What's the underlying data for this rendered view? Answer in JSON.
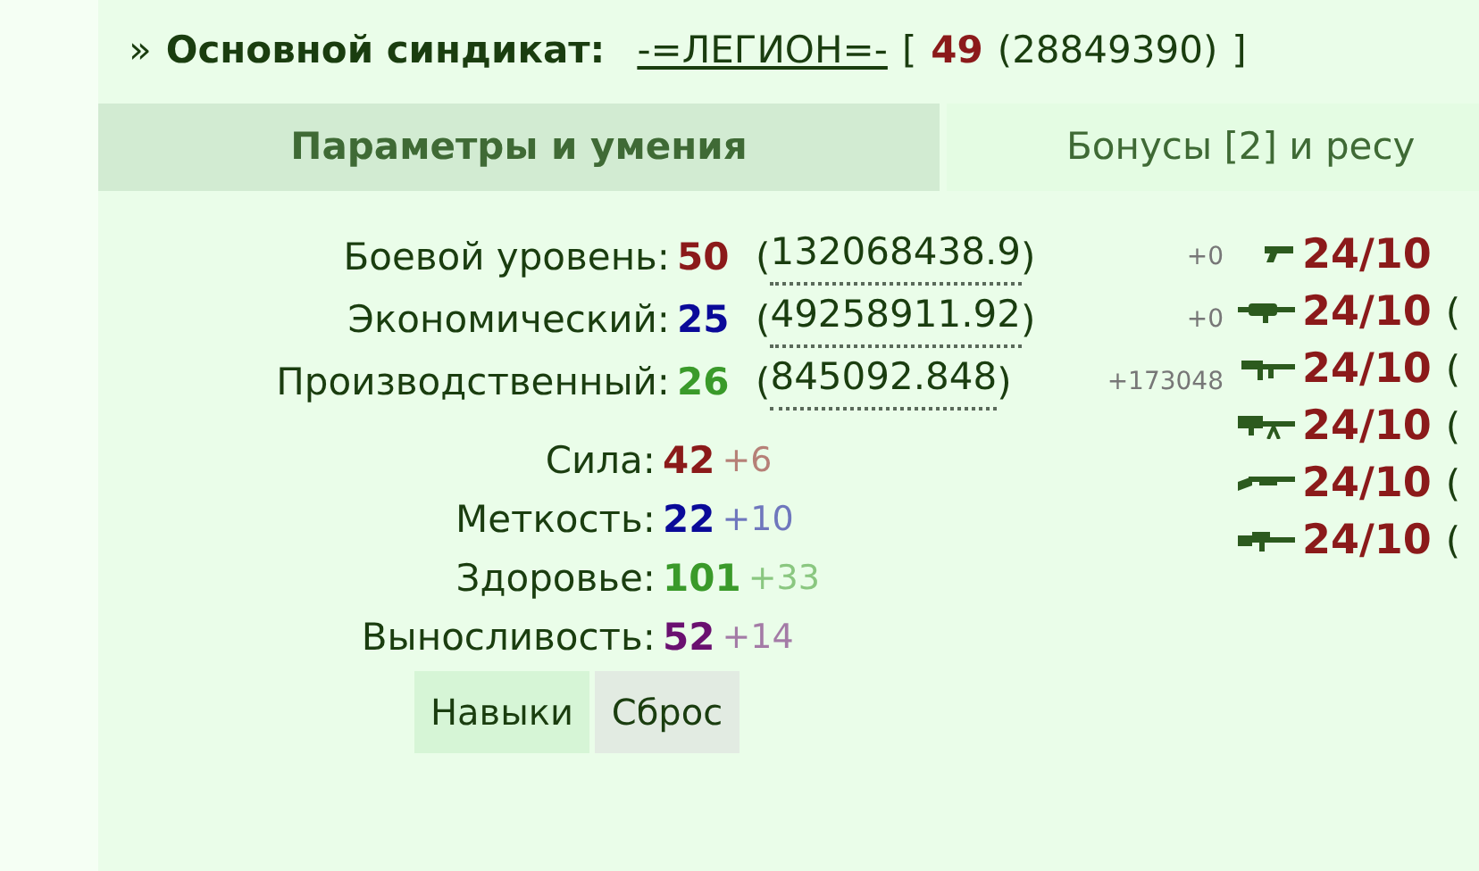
{
  "header": {
    "prefix": "»",
    "label": "Основной синдикат:",
    "syndicate": "-=ЛЕГИОН=-",
    "open_bracket": "[",
    "level": "49",
    "points": "(28849390)",
    "close_bracket": "]"
  },
  "tabs": [
    {
      "label": "Параметры и умения",
      "selected": true
    },
    {
      "label": "Бонусы [2] и ресу",
      "selected": false
    }
  ],
  "levels": [
    {
      "label": "Боевой уровень:",
      "value": "50",
      "color": "#8b1a1a",
      "open": "(",
      "points": "132068438.9",
      "close": ")",
      "bonus": "+0"
    },
    {
      "label": "Экономический:",
      "value": "25",
      "color": "#0a0a99",
      "open": "(",
      "points": "49258911.92",
      "close": ")",
      "bonus": "+0"
    },
    {
      "label": "Производственный:",
      "value": "26",
      "color": "#3a9a2a",
      "open": "(",
      "points": "845092.848",
      "close": ")",
      "bonus": "+173048"
    }
  ],
  "attributes": [
    {
      "label": "Сила:",
      "value": "42",
      "color": "#8b1a1a",
      "bonus": "+6"
    },
    {
      "label": "Меткость:",
      "value": "22",
      "color": "#0a0a99",
      "bonus": "+10"
    },
    {
      "label": "Здоровье:",
      "value": "101",
      "color": "#3a9a2a",
      "bonus": "+33"
    },
    {
      "label": "Выносливость:",
      "value": "52",
      "color": "#6a1070",
      "bonus": "+14"
    }
  ],
  "buttons": [
    {
      "label": "Навыки",
      "kind": "skills"
    },
    {
      "label": "Сброс",
      "kind": "reset"
    }
  ],
  "weapons": [
    {
      "kind": "pistol",
      "value": "24/10"
    },
    {
      "kind": "launcher",
      "value": "24/10",
      "suffix": "("
    },
    {
      "kind": "smg",
      "value": "24/10",
      "suffix": "("
    },
    {
      "kind": "machinegun",
      "value": "24/10",
      "suffix": "("
    },
    {
      "kind": "shotgun",
      "value": "24/10",
      "suffix": "("
    },
    {
      "kind": "rifle",
      "value": "24/10",
      "suffix": "("
    }
  ]
}
